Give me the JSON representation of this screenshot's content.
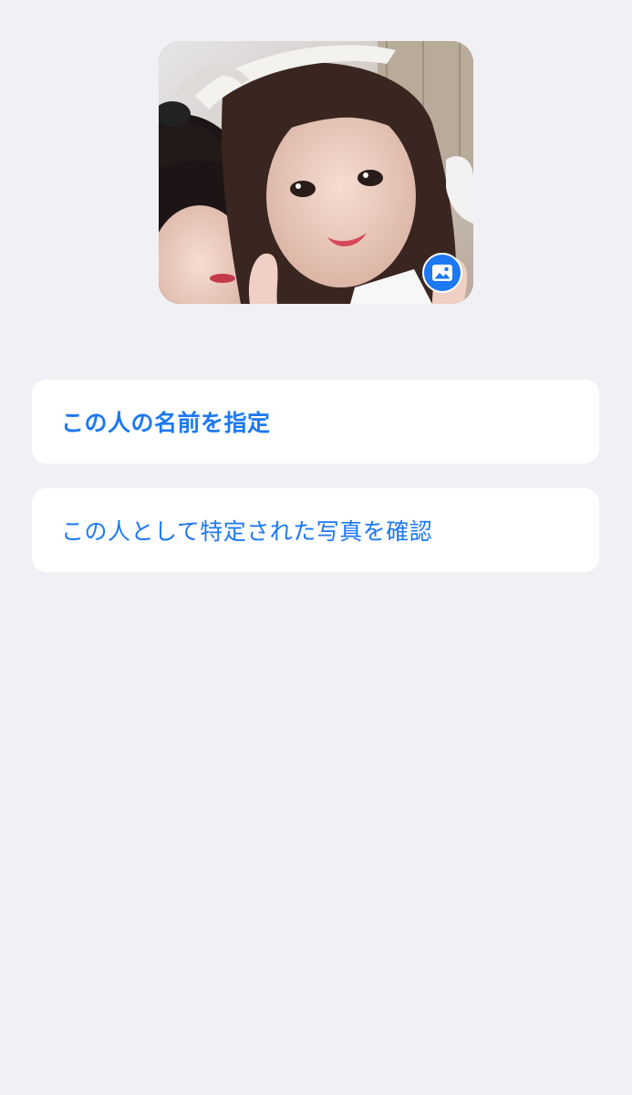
{
  "person_photo": {
    "badge_icon": "photo-icon"
  },
  "actions": {
    "set_name_label": "この人の名前を指定",
    "review_photos_label": "この人として特定された写真を確認"
  },
  "colors": {
    "accent": "#1c78f3",
    "background": "#f1f0f5",
    "card": "#ffffff"
  }
}
